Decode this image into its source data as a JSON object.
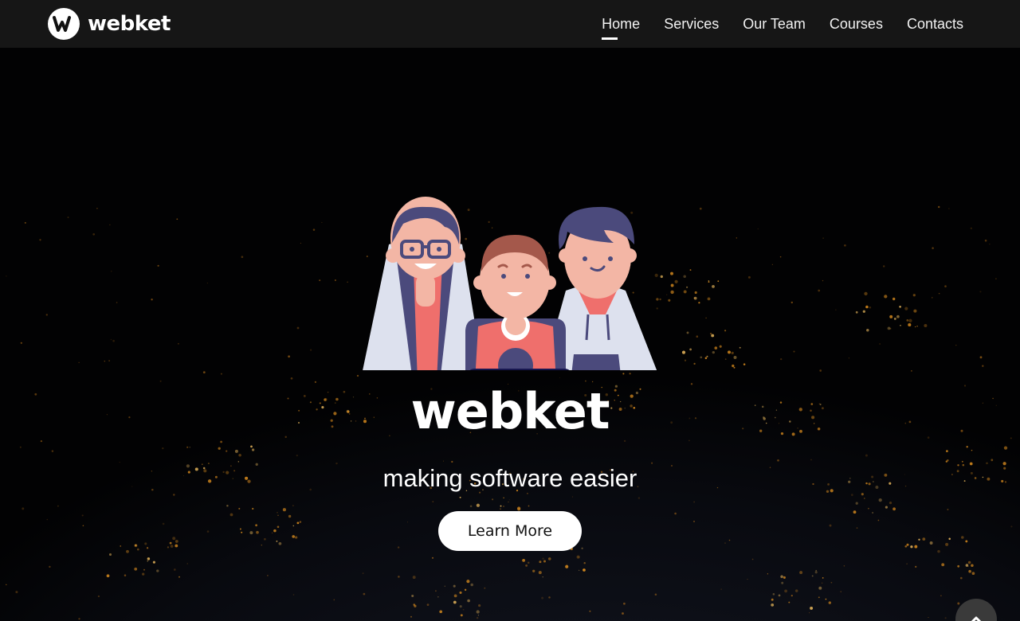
{
  "header": {
    "brand_name": "webket",
    "nav": [
      {
        "label": "Home",
        "active": true
      },
      {
        "label": "Services",
        "active": false
      },
      {
        "label": "Our Team",
        "active": false
      },
      {
        "label": "Courses",
        "active": false
      },
      {
        "label": "Contacts",
        "active": false
      }
    ]
  },
  "hero": {
    "title": "webket",
    "subtitle": "making software easier",
    "cta_label": "Learn More"
  },
  "icons": {
    "brand": "webket-logo-icon",
    "illustration": "team-illustration",
    "scroll_top": "chevron-up-icon"
  },
  "colors": {
    "header_bg": "#161616",
    "hero_bg": "#020203",
    "accent_coral": "#ef6f6c",
    "accent_navy": "#171650",
    "text": "#ffffff"
  }
}
